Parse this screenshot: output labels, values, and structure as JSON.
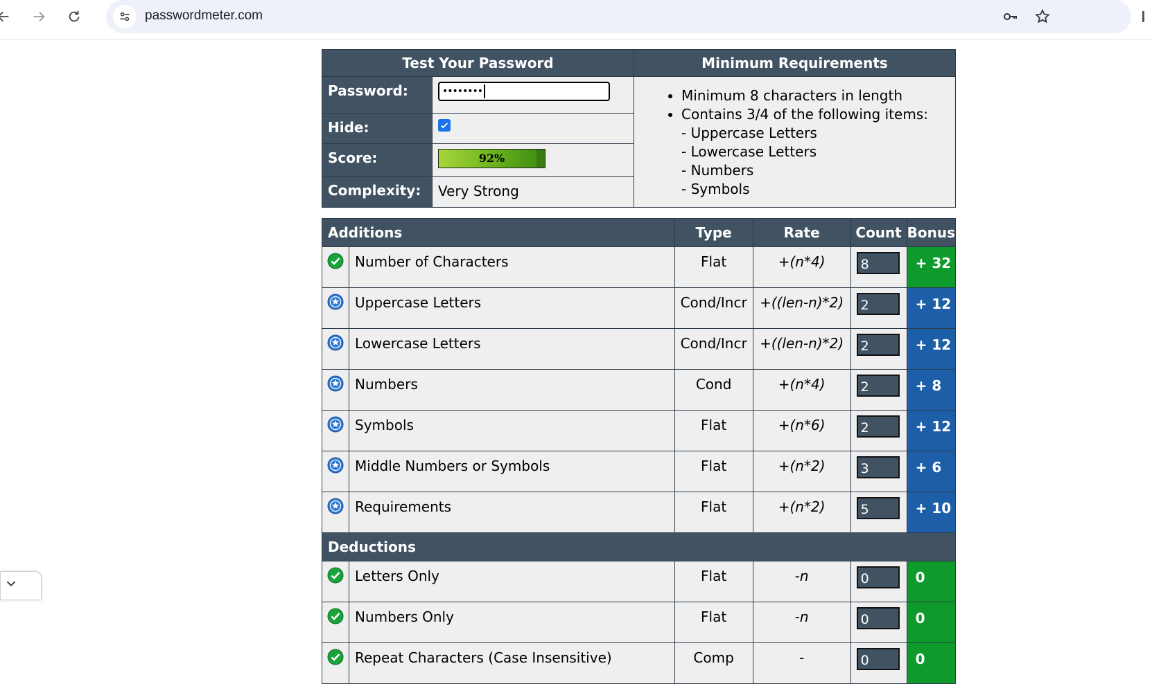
{
  "browser": {
    "url": "passwordmeter.com"
  },
  "test_panel": {
    "title": "Test Your Password",
    "password_label": "Password:",
    "password_value": "••••••••",
    "hide_label": "Hide:",
    "hide_checked": true,
    "score_label": "Score:",
    "score_text": "92%",
    "score_fraction": 0.92,
    "complexity_label": "Complexity:",
    "complexity_value": "Very Strong"
  },
  "requirements": {
    "title": "Minimum Requirements",
    "items": [
      "Minimum 8 characters in length",
      "Contains 3/4 of the following items:"
    ],
    "sub_items": [
      "- Uppercase Letters",
      "- Lowercase Letters",
      "- Numbers",
      "- Symbols"
    ]
  },
  "scoring": {
    "additions_title": "Additions",
    "deductions_title": "Deductions",
    "columns": {
      "type": "Type",
      "rate": "Rate",
      "count": "Count",
      "bonus": "Bonus"
    },
    "additions": [
      {
        "icon": "check-icon",
        "name": "Number of Characters",
        "type": "Flat",
        "rate": "+(n*4)",
        "count": "8",
        "bonus": "+ 32",
        "bonus_color": "#0f9b2c"
      },
      {
        "icon": "star-icon",
        "name": "Uppercase Letters",
        "type": "Cond/Incr",
        "rate": "+((len-n)*2)",
        "count": "2",
        "bonus": "+ 12",
        "bonus_color": "#1d5ea8"
      },
      {
        "icon": "star-icon",
        "name": "Lowercase Letters",
        "type": "Cond/Incr",
        "rate": "+((len-n)*2)",
        "count": "2",
        "bonus": "+ 12",
        "bonus_color": "#1d5ea8"
      },
      {
        "icon": "star-icon",
        "name": "Numbers",
        "type": "Cond",
        "rate": "+(n*4)",
        "count": "2",
        "bonus": "+ 8",
        "bonus_color": "#1d5ea8"
      },
      {
        "icon": "star-icon",
        "name": "Symbols",
        "type": "Flat",
        "rate": "+(n*6)",
        "count": "2",
        "bonus": "+ 12",
        "bonus_color": "#1d5ea8"
      },
      {
        "icon": "star-icon",
        "name": "Middle Numbers or Symbols",
        "type": "Flat",
        "rate": "+(n*2)",
        "count": "3",
        "bonus": "+ 6",
        "bonus_color": "#1d5ea8"
      },
      {
        "icon": "star-icon",
        "name": "Requirements",
        "type": "Flat",
        "rate": "+(n*2)",
        "count": "5",
        "bonus": "+ 10",
        "bonus_color": "#1d5ea8"
      }
    ],
    "deductions": [
      {
        "icon": "check-icon",
        "name": "Letters Only",
        "type": "Flat",
        "rate": "-n",
        "count": "0",
        "bonus": "0",
        "bonus_color": "#0f9b2c"
      },
      {
        "icon": "check-icon",
        "name": "Numbers Only",
        "type": "Flat",
        "rate": "-n",
        "count": "0",
        "bonus": "0",
        "bonus_color": "#0f9b2c"
      },
      {
        "icon": "check-icon",
        "name": "Repeat Characters (Case Insensitive)",
        "type": "Comp",
        "rate": "-",
        "count": "0",
        "bonus": "0",
        "bonus_color": "#0f9b2c"
      }
    ]
  }
}
